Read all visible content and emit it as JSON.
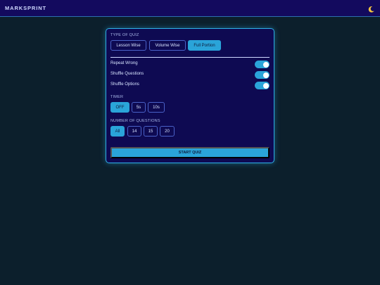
{
  "app": {
    "brand": "MARKSPRINT"
  },
  "theme": {
    "icon": "moon-icon"
  },
  "quiz_type": {
    "label": "TYPE OF QUIZ",
    "options": [
      "Lesson Wise",
      "Volume Wise",
      "Full Portion"
    ],
    "selected": "Full Portion"
  },
  "options": [
    {
      "label": "Repeat Wrong",
      "enabled": true
    },
    {
      "label": "Shuffle Questions",
      "enabled": true
    },
    {
      "label": "Shuffle Options",
      "enabled": true
    }
  ],
  "timer": {
    "label": "TIMER",
    "options": [
      "OFF",
      "5s",
      "10s"
    ],
    "selected": "OFF"
  },
  "questions": {
    "label": "NUMBER OF QUESTIONS",
    "options": [
      "All",
      "14",
      "15",
      "20"
    ],
    "selected": "All"
  },
  "start_button": {
    "label": "START QUIZ"
  },
  "colors": {
    "background": "#0c1f2c",
    "topbar": "#130a5e",
    "card": "#0e0a52",
    "accent": "#2aa4d9",
    "chip_border": "#4a62c8"
  }
}
